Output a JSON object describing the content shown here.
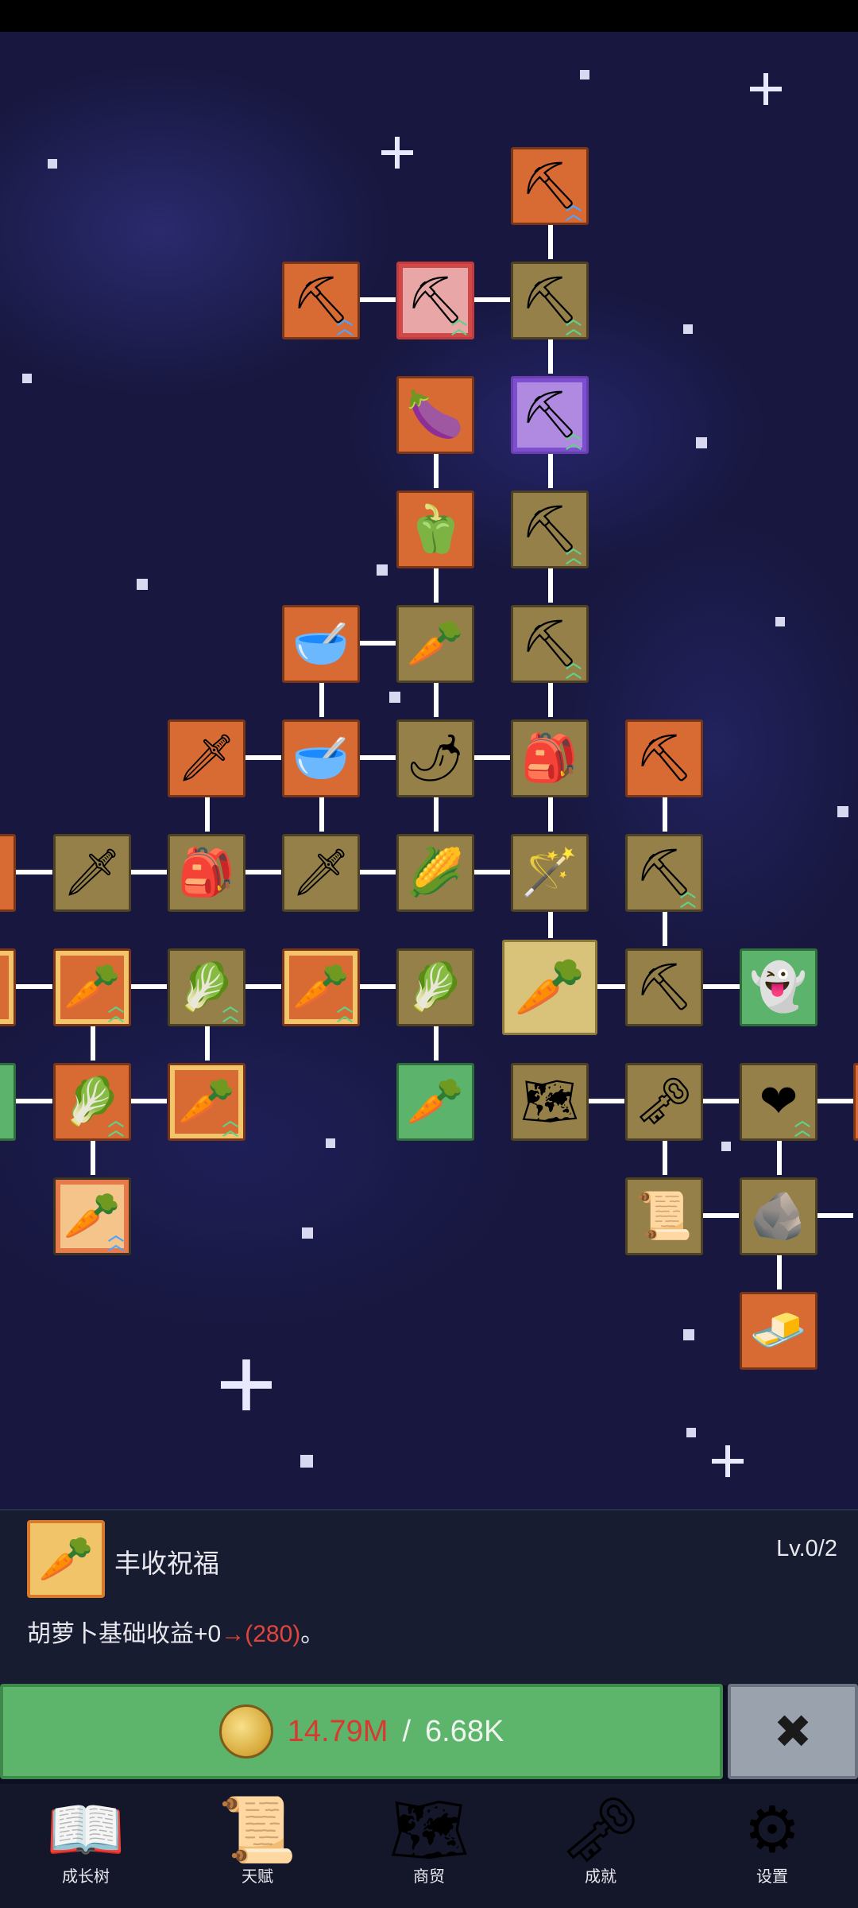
{
  "skill_tree": {
    "nodes": [
      {
        "id": "n1",
        "icon": "shovel-icon",
        "glyph": "⛏",
        "color": "orange",
        "arrows": "blue"
      },
      {
        "id": "n2",
        "icon": "shovel-icon",
        "glyph": "⛏",
        "color": "orange",
        "arrows": "blue"
      },
      {
        "id": "n3",
        "icon": "shovel-icon",
        "glyph": "⛏",
        "color": "pink",
        "arrows": "green"
      },
      {
        "id": "n4",
        "icon": "shovel-icon",
        "glyph": "⛏",
        "color": "olive",
        "arrows": "green"
      },
      {
        "id": "n5",
        "icon": "eggplant-icon",
        "glyph": "🍆",
        "color": "orange",
        "arrows": ""
      },
      {
        "id": "n6",
        "icon": "shovel-icon",
        "glyph": "⛏",
        "color": "purple",
        "arrows": "green"
      },
      {
        "id": "n7",
        "icon": "pepper-icon",
        "glyph": "🫑",
        "color": "orange",
        "arrows": ""
      },
      {
        "id": "n8",
        "icon": "shovel-icon",
        "glyph": "⛏",
        "color": "olive",
        "arrows": "green"
      },
      {
        "id": "n9",
        "icon": "bowl-icon",
        "glyph": "🥣",
        "color": "orange",
        "arrows": ""
      },
      {
        "id": "n10",
        "icon": "radish-icon",
        "glyph": "🥕",
        "color": "olive",
        "arrows": ""
      },
      {
        "id": "n11",
        "icon": "shovel-icon",
        "glyph": "⛏",
        "color": "olive",
        "arrows": "green"
      },
      {
        "id": "n12",
        "icon": "sword-icon",
        "glyph": "🗡",
        "color": "orange",
        "arrows": ""
      },
      {
        "id": "n13",
        "icon": "bowl-icon",
        "glyph": "🥣",
        "color": "orange",
        "arrows": ""
      },
      {
        "id": "n14",
        "icon": "chili-icon",
        "glyph": "🌶",
        "color": "olive",
        "arrows": ""
      },
      {
        "id": "n15",
        "icon": "backpack-icon",
        "glyph": "🎒",
        "color": "olive",
        "arrows": ""
      },
      {
        "id": "n16",
        "icon": "pickaxe-icon",
        "glyph": "⛏",
        "color": "orange",
        "arrows": ""
      },
      {
        "id": "n17",
        "icon": "sword-icon",
        "glyph": "🗡",
        "color": "olive",
        "arrows": ""
      },
      {
        "id": "n18",
        "icon": "backpack-icon",
        "glyph": "🎒",
        "color": "olive",
        "arrows": ""
      },
      {
        "id": "n19",
        "icon": "sword-icon",
        "glyph": "🗡",
        "color": "olive",
        "arrows": ""
      },
      {
        "id": "n20",
        "icon": "corn-icon",
        "glyph": "🌽",
        "color": "olive",
        "arrows": ""
      },
      {
        "id": "n21",
        "icon": "wand-icon",
        "glyph": "🪄",
        "color": "olive",
        "arrows": ""
      },
      {
        "id": "n22",
        "icon": "pickaxe-icon",
        "glyph": "⛏",
        "color": "olive",
        "arrows": "green"
      },
      {
        "id": "n23",
        "icon": "carrot-icon",
        "glyph": "🥕",
        "color": "orange gold",
        "arrows": "green"
      },
      {
        "id": "n24",
        "icon": "cabbage-icon",
        "glyph": "🥬",
        "color": "olive",
        "arrows": "green"
      },
      {
        "id": "n25",
        "icon": "carrot-icon",
        "glyph": "🥕",
        "color": "orange gold",
        "arrows": "green"
      },
      {
        "id": "n26",
        "icon": "cabbage-icon",
        "glyph": "🥬",
        "color": "olive",
        "arrows": ""
      },
      {
        "id": "n27",
        "icon": "carrot-icon",
        "glyph": "🥕",
        "color": "big",
        "arrows": ""
      },
      {
        "id": "n28",
        "icon": "pickaxe-icon",
        "glyph": "⛏",
        "color": "olive",
        "arrows": ""
      },
      {
        "id": "n29",
        "icon": "ghost-icon",
        "glyph": "👻",
        "color": "green",
        "arrows": ""
      },
      {
        "id": "n30",
        "icon": "cabbage-icon",
        "glyph": "🥬",
        "color": "orange",
        "arrows": "green"
      },
      {
        "id": "n31",
        "icon": "carrot-icon",
        "glyph": "🥕",
        "color": "orange gold",
        "arrows": "green"
      },
      {
        "id": "n32",
        "icon": "parsnip-icon",
        "glyph": "🥕",
        "color": "green",
        "arrows": ""
      },
      {
        "id": "n33",
        "icon": "map-icon",
        "glyph": "🗺",
        "color": "olive",
        "arrows": ""
      },
      {
        "id": "n34",
        "icon": "key-icon",
        "glyph": "🗝",
        "color": "olive",
        "arrows": ""
      },
      {
        "id": "n35",
        "icon": "heart-icon",
        "glyph": "❤",
        "color": "olive",
        "arrows": "green"
      },
      {
        "id": "n36",
        "icon": "carrot-icon",
        "glyph": "🥕",
        "color": "dotted",
        "arrows": "blue"
      },
      {
        "id": "n37",
        "icon": "scroll-icon",
        "glyph": "📜",
        "color": "olive",
        "arrows": ""
      },
      {
        "id": "n38",
        "icon": "stone-icon",
        "glyph": "🪨",
        "color": "olive",
        "arrows": ""
      },
      {
        "id": "n39",
        "icon": "gold-bar-icon",
        "glyph": "🧈",
        "color": "orange",
        "arrows": ""
      }
    ]
  },
  "detail": {
    "name": "丰收祝福",
    "level": "Lv.0/2",
    "desc_prefix": "胡萝卜基础收益+0",
    "desc_arrow": "→",
    "desc_value": "(280)",
    "desc_suffix": "。",
    "icon": "carrot-icon"
  },
  "purchase": {
    "have": "14.79M",
    "separator": " / ",
    "need": "6.68K",
    "coin_icon": "coin-icon",
    "close_icon": "close-icon"
  },
  "nav": [
    {
      "label": "成长树",
      "icon": "book-icon",
      "glyph": "📖"
    },
    {
      "label": "天赋",
      "icon": "scroll-icon",
      "glyph": "📜"
    },
    {
      "label": "商贸",
      "icon": "map-icon",
      "glyph": "🗺"
    },
    {
      "label": "成就",
      "icon": "key-icon",
      "glyph": "🗝"
    },
    {
      "label": "设置",
      "icon": "gear-icon",
      "glyph": "⚙"
    }
  ],
  "colors": {
    "accent_green": "#5db46b",
    "cost_red": "#d83a30",
    "background": "#17173f"
  }
}
